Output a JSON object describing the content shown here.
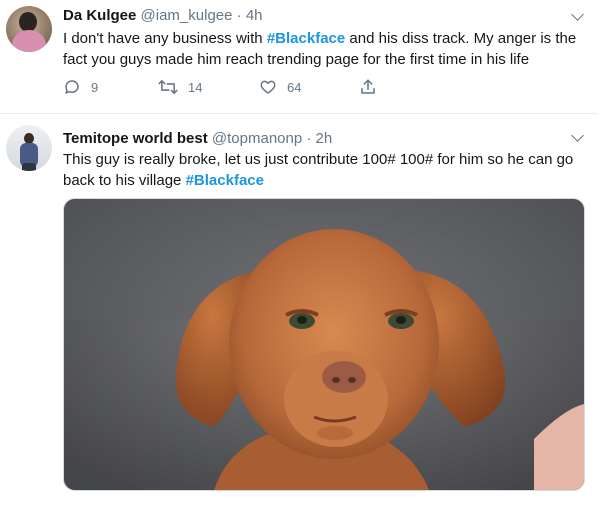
{
  "tweets": [
    {
      "display_name": "Da Kulgee",
      "handle": "@iam_kulgee",
      "separator": "·",
      "time": "4h",
      "text_before": "I don't have any business with ",
      "hashtag": "#Blackface",
      "text_after": " and his diss track. My anger is the fact you guys made him reach trending page for the first time in his life",
      "reply_count": "9",
      "retweet_count": "14",
      "like_count": "64"
    },
    {
      "display_name": "Temitope world best",
      "handle": "@topmanonp",
      "separator": "·",
      "time": "2h",
      "text_before": "This guy is really broke, let us just contribute 100# 100# for him so he can go back to his village ",
      "hashtag": "#Blackface",
      "text_after": ""
    }
  ],
  "colors": {
    "hashtag": "#1b95e0",
    "secondary_text": "#657786",
    "divider": "#e6ecf0"
  },
  "icons": [
    "chevron-down-icon",
    "reply-icon",
    "retweet-icon",
    "like-icon",
    "share-icon"
  ]
}
